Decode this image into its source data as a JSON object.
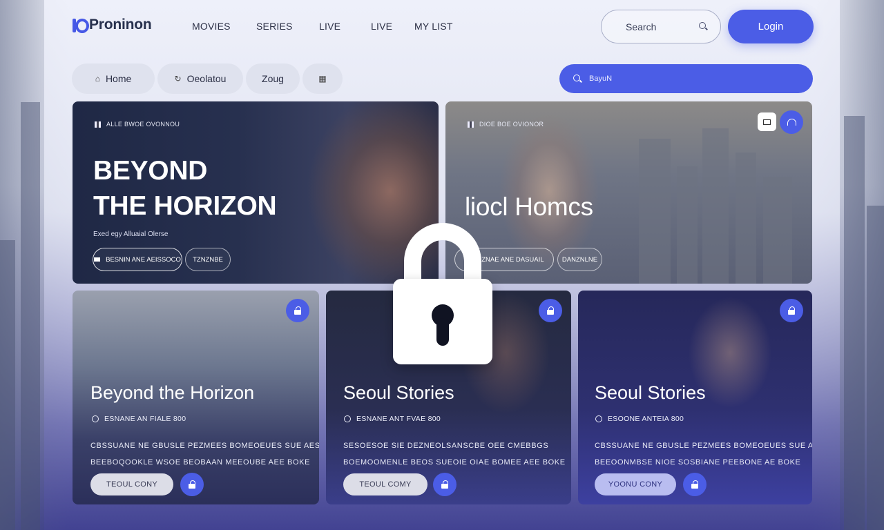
{
  "brand": {
    "name": "Proninon",
    "accent": "#4b5de6"
  },
  "nav": [
    "MOVIES",
    "SERIES",
    "LIVE",
    "LIVE",
    "MY LIST"
  ],
  "search": {
    "placeholder": "Search",
    "icon": "search-icon"
  },
  "login_label": "Login",
  "chips": [
    {
      "label": "Home",
      "icon": "home-icon"
    },
    {
      "label": "Oeolatou",
      "icon": "refresh-icon"
    },
    {
      "label": "Zoug",
      "icon": ""
    },
    {
      "label": "",
      "icon": "grid-icon"
    }
  ],
  "blue_bar": {
    "text": "BayuN",
    "icon": "search-icon"
  },
  "hero": [
    {
      "tag": "ALLE BWOE OVONNOU",
      "title_line1": "BEYOND",
      "title_line2": "THE HORIZON",
      "meta": "Exed egy Alluaial Olerse",
      "primary_button": "BESNIN ANE AEISSOCO",
      "secondary_button": "TZNZNBE"
    },
    {
      "tag": "DIOE BOE OVIONOR",
      "title": "liocl Homcs",
      "primary_button": "PLENZNAE ANE DASUAIL",
      "secondary_button": "DANZNLNE"
    }
  ],
  "tiles": [
    {
      "title": "Beyond the Horizon",
      "info": "ESNANE AN FIALE 800",
      "desc_line1": "CBSSUANE NE GBUSLE PEZMEES BOMEOEUES SUE AESBOESS",
      "desc_line2": "BEEBOQOOKLE WSOE BEOBAAN MEEOUBE AEE BOKE",
      "button": "TEOUL CONY"
    },
    {
      "title": "Seoul Stories",
      "info": "ESNANE ANT FVAE 800",
      "desc_line1": "SESOESOE SIE DEZNEOLSANSCBE OEE CMEBBGS",
      "desc_line2": "BOEMOOMENLE BEOS SUEOIE OIAE BOMEE AEE BOKE",
      "button": "TEOUL COMY"
    },
    {
      "title": "Seoul Stories",
      "info": "ESOONE ANTEIA 800",
      "desc_line1": "CBSSUANE NE GBUSLE PEZMEES BOMEOEUES SUE AESBOESS",
      "desc_line2": "BEEOONMBSE NIOE SOSBIANE PEEBONE AE BOKE",
      "button": "YOONU CONY"
    }
  ],
  "overlay": {
    "icon": "lock-icon"
  }
}
